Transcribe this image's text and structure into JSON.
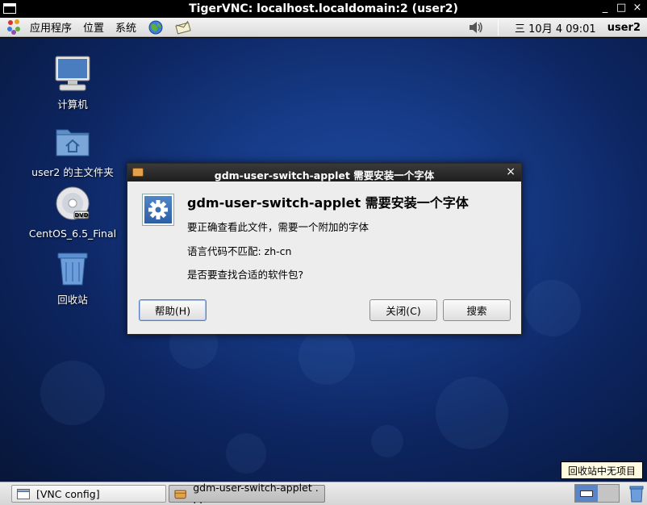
{
  "vnc": {
    "title": "TigerVNC: localhost.localdomain:2 (user2)",
    "minimize": "_",
    "maximize": "□",
    "close": "×"
  },
  "top_panel": {
    "menus": [
      "应用程序",
      "位置",
      "系统"
    ],
    "clock": "三 10月  4 09:01",
    "user": "user2"
  },
  "desktop_icons": [
    {
      "label": "计算机",
      "icon": "computer-icon"
    },
    {
      "label": "user2 的主文件夹",
      "icon": "home-folder-icon"
    },
    {
      "label": "CentOS_6.5_Final",
      "icon": "dvd-icon"
    },
    {
      "label": "回收站",
      "icon": "trash-icon"
    }
  ],
  "dialog": {
    "title": "gdm-user-switch-applet 需要安装一个字体",
    "heading": "gdm-user-switch-applet 需要安装一个字体",
    "line1": "要正确查看此文件，需要一个附加的字体",
    "line2": "语言代码不匹配: zh-cn",
    "line3": "是否要查找合适的软件包?",
    "help_label": "帮助(H)",
    "close_label": "关闭(C)",
    "search_label": "搜索",
    "close_glyph": "×"
  },
  "tooltip": "回收站中无项目",
  "taskbar": {
    "items": [
      "[VNC config]",
      "gdm-user-switch-applet . . ."
    ]
  },
  "colors": {
    "desktop_bg": "#163a86",
    "dialog_titlebar": "#2a2a2a",
    "panel_bg": "#e4e4e4"
  }
}
